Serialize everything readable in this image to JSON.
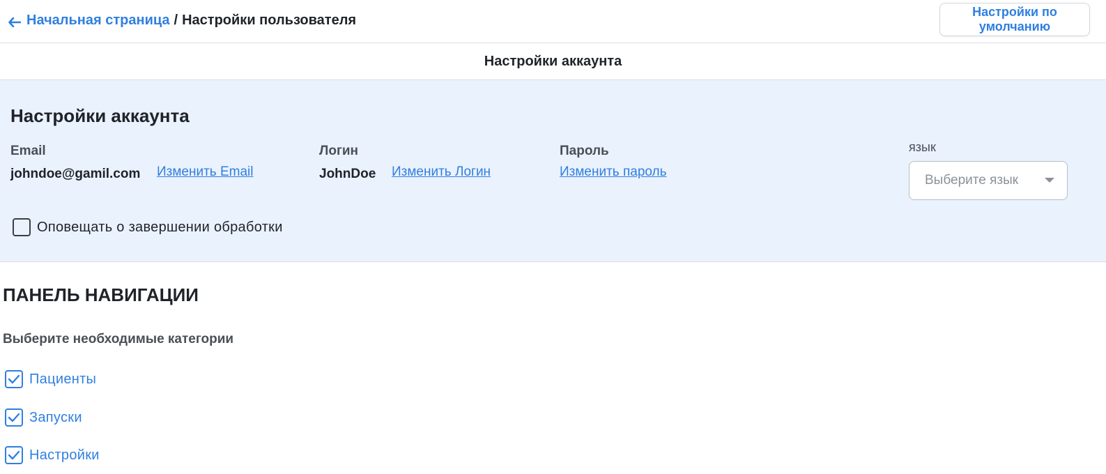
{
  "header": {
    "breadcrumb_home": "Начальная страница",
    "breadcrumb_separator": "/",
    "breadcrumb_current": "Настройки пользователя",
    "defaults_button": "Настройки по умолчанию"
  },
  "section_tab": {
    "title": "Настройки аккаунта"
  },
  "account": {
    "title": "Настройки аккаунта",
    "email": {
      "label": "Email",
      "value": "johndoe@gamil.com",
      "change_link": "Изменить Email"
    },
    "login": {
      "label": "Логин",
      "value": "JohnDoe",
      "change_link": "Изменить Логин"
    },
    "password": {
      "label": "Пароль",
      "change_link": "Изменить пароль"
    },
    "language": {
      "label": "язык",
      "placeholder": "Выберите язык"
    },
    "notify": {
      "label": "Оповещать о завершении обработки",
      "checked": false
    }
  },
  "nav_panel": {
    "title": "ПАНЕЛЬ НАВИГАЦИИ",
    "subtitle": "Выберите необходимые категории",
    "items": [
      {
        "label": "Пациенты",
        "checked": true
      },
      {
        "label": "Запуски",
        "checked": true
      },
      {
        "label": "Настройки",
        "checked": true
      }
    ]
  },
  "colors": {
    "accent": "#2f7fe0",
    "panel_background": "#eaf2fd",
    "text": "#1f2329"
  }
}
